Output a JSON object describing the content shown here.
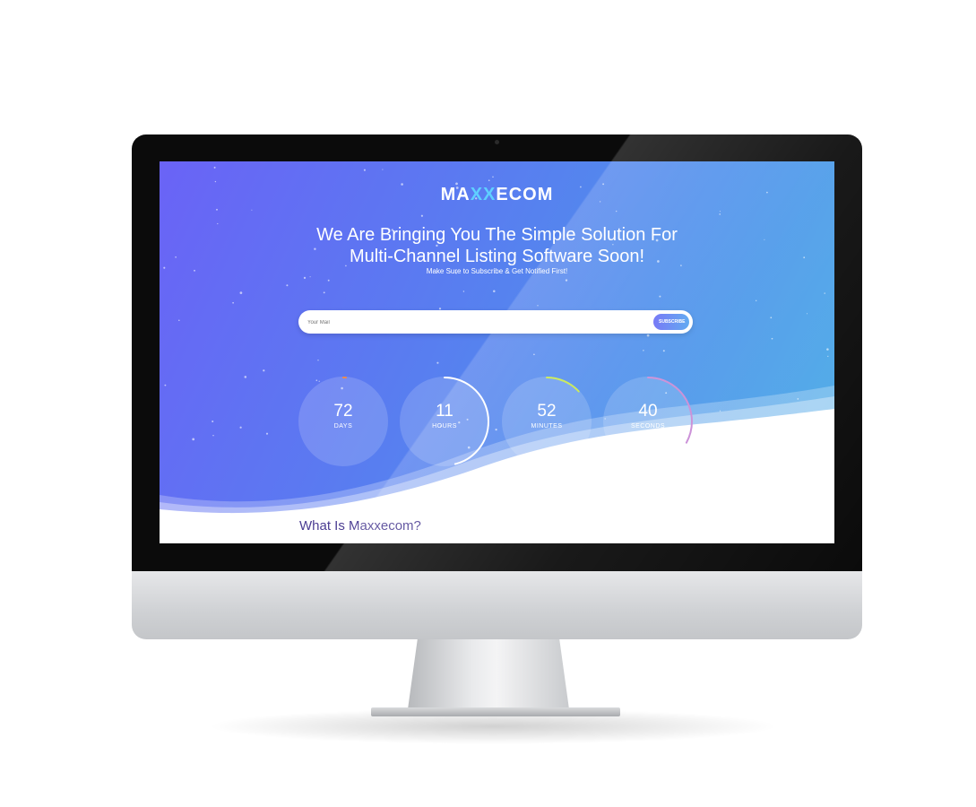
{
  "page": {
    "logo": {
      "part1": "MA",
      "part2": "XX",
      "part3": "ECOM"
    },
    "headline_line1": "We Are Bringing You The Simple Solution For",
    "headline_line2": "Multi-Channel Listing Software Soon!",
    "subheadline": "Make Sure to Subscribe & Get Notified First!",
    "subscribe": {
      "placeholder": "Your Mail",
      "button_label": "SUBSCRIBE"
    },
    "countdown": [
      {
        "value": "72",
        "label": "DAYS",
        "progress": 0.01,
        "color": "#f08a4b"
      },
      {
        "value": "11",
        "label": "HOURS",
        "progress": 0.46,
        "color": "#ffffff"
      },
      {
        "value": "52",
        "label": "MINUTES",
        "progress": 0.13,
        "color": "#c5e84a"
      },
      {
        "value": "40",
        "label": "SECONDS",
        "progress": 0.33,
        "color": "#c98cd6"
      }
    ],
    "section_title": "What Is Maxxecom?"
  },
  "colors": {
    "gradient_start": "#6a63f6",
    "gradient_end": "#4eb1e6",
    "section_title": "#4c3e93"
  }
}
